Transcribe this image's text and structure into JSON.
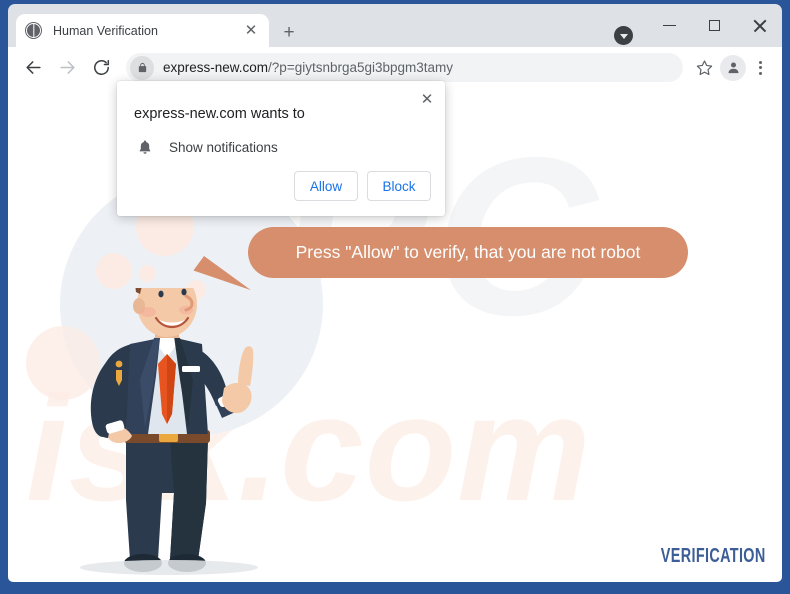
{
  "browser": {
    "tab": {
      "title": "Human Verification",
      "favicon_icon": "globe-icon",
      "close_icon": "close-icon"
    },
    "new_tab_icon": "plus-icon",
    "window_controls": {
      "minimize_icon": "minimize-icon",
      "maximize_icon": "maximize-icon",
      "close_icon": "close-icon"
    },
    "download_indicator_icon": "download-chevron-icon",
    "toolbar": {
      "back_icon": "back-arrow-icon",
      "forward_icon": "forward-arrow-icon",
      "reload_icon": "reload-icon",
      "lock_icon": "lock-icon",
      "bookmark_icon": "star-icon",
      "profile_icon": "person-avatar-icon",
      "menu_icon": "three-dot-menu-icon",
      "url_host": "express-new.com",
      "url_path": "/?p=giytsnbrga5gi3bpgm3tamy",
      "url_full": "express-new.com/?p=giytsnbrga5gi3bpgm3tamy"
    }
  },
  "dialog": {
    "title": "express-new.com wants to",
    "permission_icon": "bell-icon",
    "permission_label": "Show notifications",
    "allow_label": "Allow",
    "block_label": "Block",
    "close_icon": "close-icon"
  },
  "page": {
    "speech_bubble_text": "Press \"Allow\" to verify, that you are not robot",
    "verification_label": "VERIFICATION",
    "watermark_top": "PC",
    "watermark_bottom": "isk.com",
    "character_alt": "cartoon-businessman-pointing-up"
  },
  "colors": {
    "window_frame": "#2a5699",
    "speech_bubble": "#d78e6c",
    "verification_text": "#3c5d96",
    "dialog_button_text": "#1a73e8",
    "suit": "#2b3a4d",
    "tie": "#e8541f",
    "skin": "#f4c9a8",
    "hair": "#7b4a33"
  }
}
